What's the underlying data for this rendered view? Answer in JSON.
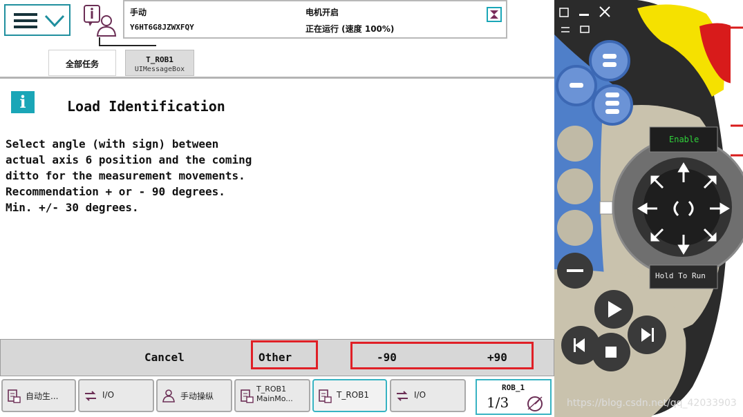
{
  "status": {
    "mode": "手动",
    "controller_id": "Y6HT6G8JZWXFQY",
    "motor_state": "电机开启",
    "run_state": "正在运行 (速度 100%)"
  },
  "tabs": [
    {
      "label": "全部任务"
    },
    {
      "label": "T_ROB1",
      "sub": "UIMessageBox"
    }
  ],
  "message": {
    "title": "Load Identification",
    "info_glyph": "i",
    "lines": [
      "Select angle (with sign) between",
      "actual axis 6 position and the coming",
      "ditto for the measurement movements.",
      "Recommendation + or - 90 degrees.",
      "Min. +/- 30 degrees."
    ]
  },
  "buttons": {
    "cancel": "Cancel",
    "other": "Other",
    "minus90": "-90",
    "plus90": "+90"
  },
  "taskbar": [
    {
      "label": "自动生...",
      "icon": "program-icon"
    },
    {
      "label": "I/O",
      "icon": "io-icon"
    },
    {
      "label": "手动操纵",
      "icon": "jog-icon"
    },
    {
      "label": "T_ROB1",
      "label2": "MainMo...",
      "icon": "program-icon"
    },
    {
      "label": "T_ROB1",
      "icon": "program-icon"
    },
    {
      "label": "I/O",
      "icon": "io-icon"
    }
  ],
  "quickset": {
    "rob": "ROB_1",
    "speed_fraction": "1/3"
  },
  "pendant": {
    "enable_label": "Enable",
    "hold_to_run_label": "Hold To Run"
  },
  "watermark": "https://blog.csdn.net/qq_42033903",
  "colors": {
    "accent": "#1aa6b7",
    "highlight": "#e01f26",
    "pendant_body": "#2b2b2b",
    "pendant_blue": "#4f7fc9",
    "emergency_red": "#d81b1b",
    "emergency_yellow": "#f5e100"
  }
}
